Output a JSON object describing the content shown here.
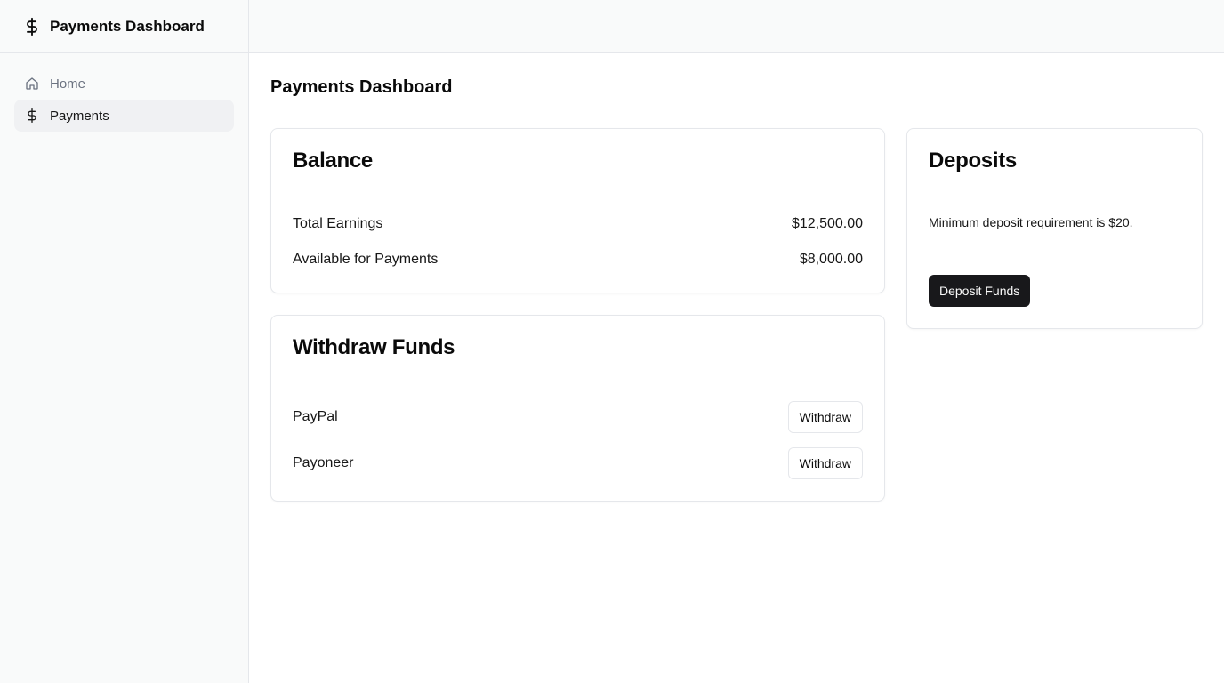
{
  "app": {
    "title": "Payments Dashboard",
    "logo_icon": "dollar-icon"
  },
  "sidebar": {
    "items": [
      {
        "label": "Home",
        "icon": "home-icon",
        "active": false
      },
      {
        "label": "Payments",
        "icon": "dollar-icon",
        "active": true
      }
    ]
  },
  "page": {
    "title": "Payments Dashboard"
  },
  "balance": {
    "title": "Balance",
    "rows": [
      {
        "label": "Total Earnings",
        "value": "$12,500.00"
      },
      {
        "label": "Available for Payments",
        "value": "$8,000.00"
      }
    ]
  },
  "withdraw": {
    "title": "Withdraw Funds",
    "methods": [
      {
        "label": "PayPal",
        "button": "Withdraw"
      },
      {
        "label": "Payoneer",
        "button": "Withdraw"
      }
    ]
  },
  "deposits": {
    "title": "Deposits",
    "note": "Minimum deposit requirement is $20.",
    "button": "Deposit Funds"
  },
  "colors": {
    "sidebar_bg": "#f9fafa",
    "primary_button": "#18181b",
    "border": "#e5e7eb"
  }
}
